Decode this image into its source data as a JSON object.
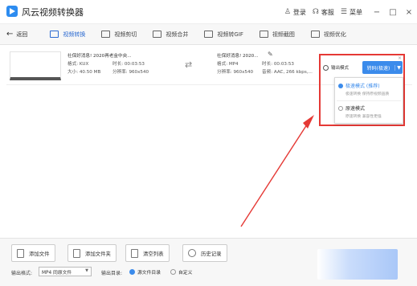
{
  "app": {
    "title": "风云视频转换器"
  },
  "header": {
    "login": "登录",
    "service": "客服",
    "menu": "菜单",
    "minimize": "−",
    "maximize": "□",
    "close": "×"
  },
  "tabs": {
    "back": "返回",
    "items": [
      {
        "label": "视频转换"
      },
      {
        "label": "视频剪切"
      },
      {
        "label": "视频合并"
      },
      {
        "label": "视频转GIF"
      },
      {
        "label": "视频截图"
      },
      {
        "label": "视频优化"
      }
    ]
  },
  "file": {
    "source": {
      "title": "社保好消息! 2020再老金中央...",
      "format": "格式: KUX",
      "duration": "时长: 00:03:53",
      "size": "大小: 40.50 MB",
      "resolution": "分辨率: 960x540"
    },
    "target": {
      "title": "社保好消息! 2020...",
      "format": "格式: MP4",
      "duration": "时长: 00:03:53",
      "resolution": "分辨率: 960x540",
      "audio": "音频: AAC, 266 kbps,..."
    }
  },
  "output": {
    "label": "输出模式",
    "button": "转码(极速)",
    "options": [
      {
        "name": "极速模式 (推荐)",
        "desc": "极速转换 保持原视频画质",
        "selected": true
      },
      {
        "name": "原速模式",
        "desc": "原速转换 兼容性更强",
        "selected": false
      }
    ],
    "close": "×"
  },
  "bottom": {
    "add_file": "添加文件",
    "add_folder": "添加文件夹",
    "clear_list": "清空列表",
    "history": "历史记录",
    "format_label": "输出格式:",
    "format_value": "MP4 同原文件",
    "dir_label": "输出目录:",
    "dir_options": [
      {
        "label": "源文件目录",
        "selected": true
      },
      {
        "label": "自定义",
        "selected": false
      }
    ]
  },
  "colors": {
    "accent": "#3b8beb",
    "highlight": "#e53935"
  }
}
